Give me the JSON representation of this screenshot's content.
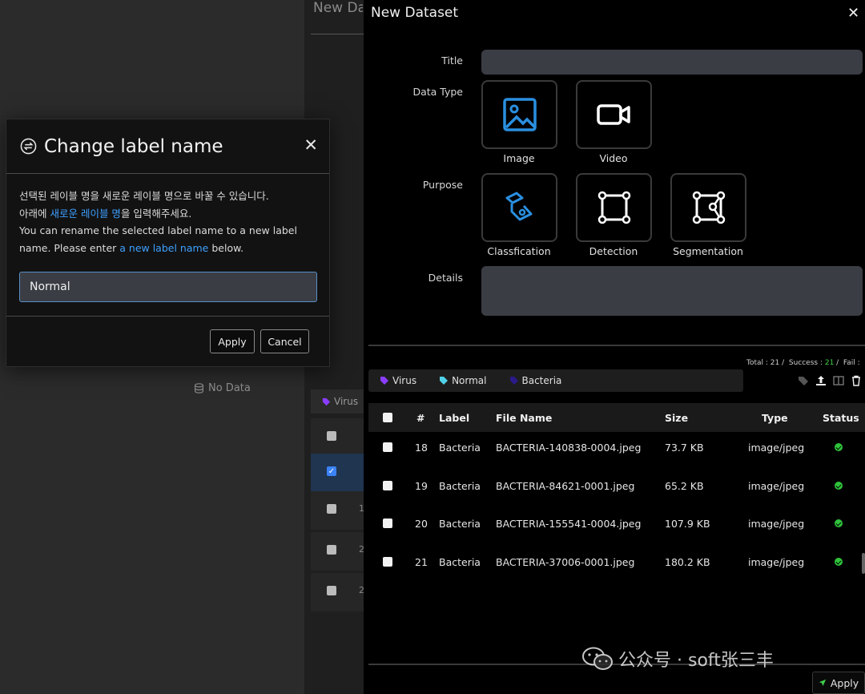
{
  "background": {
    "title_fragment": "New Da",
    "no_data": "No Data",
    "chip_label": "Virus",
    "row_numbers": [
      "",
      "",
      "1",
      "2",
      "2"
    ]
  },
  "dialog": {
    "title": "Change label name",
    "line1": "선택된 레이블 명을 새로운 레이블 명으로 바꿀 수 있습니다.",
    "line2_pre": "아래에 ",
    "line2_hl": "새로운 레이블 명",
    "line2_post": "을 입력해주세요.",
    "line3": "You can rename the selected label name to a new label",
    "line4_pre": "name. Please enter ",
    "line4_hl": "a new label name",
    "line4_post": " below.",
    "input_value": "Normal",
    "apply_label": "Apply",
    "cancel_label": "Cancel",
    "accent_color": "#3ea0ff"
  },
  "panel": {
    "title": "New Dataset",
    "title_label": "Title",
    "data_type_label": "Data Type",
    "purpose_label": "Purpose",
    "details_label": "Details",
    "data_types": [
      "Image",
      "Video"
    ],
    "purposes": [
      "Classfication",
      "Detection",
      "Segmentation"
    ],
    "stats": {
      "total_label": "Total : ",
      "total": "21",
      "success_label": "Success : ",
      "success": "21",
      "fail_label": "Fail : "
    },
    "chips": [
      {
        "label": "Virus",
        "color": "#8b3dff"
      },
      {
        "label": "Normal",
        "color": "#4fd1e8"
      },
      {
        "label": "Bacteria",
        "color": "#2a1a8a"
      }
    ],
    "columns": [
      "#",
      "Label",
      "File Name",
      "Size",
      "Type",
      "Status"
    ],
    "rows": [
      {
        "num": "18",
        "label": "Bacteria",
        "file": "BACTERIA-140838-0004.jpeg",
        "size": "73.7 KB",
        "type": "image/jpeg"
      },
      {
        "num": "19",
        "label": "Bacteria",
        "file": "BACTERIA-84621-0001.jpeg",
        "size": "65.2 KB",
        "type": "image/jpeg"
      },
      {
        "num": "20",
        "label": "Bacteria",
        "file": "BACTERIA-155541-0004.jpeg",
        "size": "107.9 KB",
        "type": "image/jpeg"
      },
      {
        "num": "21",
        "label": "Bacteria",
        "file": "BACTERIA-37006-0001.jpeg",
        "size": "180.2 KB",
        "type": "image/jpeg"
      }
    ],
    "apply_label": "Apply",
    "success_color": "#2fc33b",
    "image_icon_color": "#2a8fe0"
  },
  "watermark": "公众号 · soft张三丰"
}
